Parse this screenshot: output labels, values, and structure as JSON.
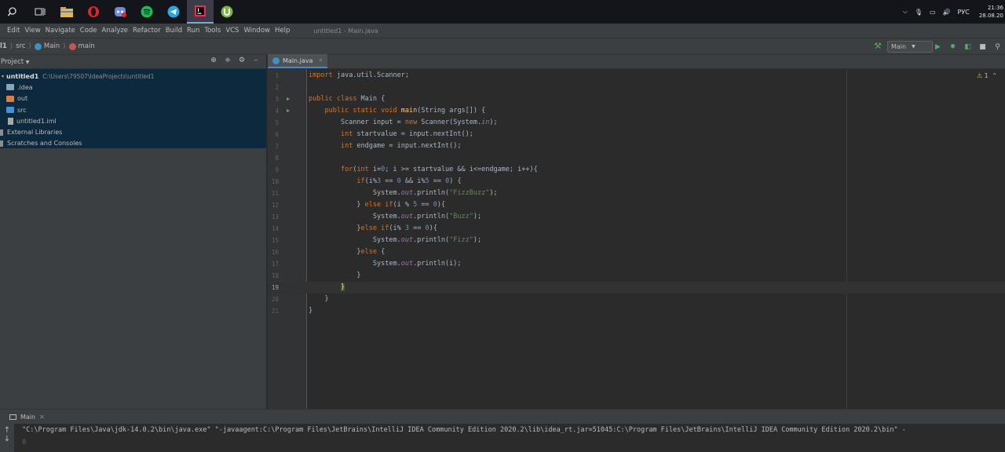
{
  "taskbar": {
    "apps": [
      "search",
      "task-view",
      "explorer",
      "opera",
      "discord",
      "spotify",
      "telegram",
      "intellij",
      "torrent"
    ],
    "lang": "РУС",
    "time": "21:36",
    "date": "28.08.20"
  },
  "menu": {
    "items": [
      "Edit",
      "View",
      "Navigate",
      "Code",
      "Analyze",
      "Refactor",
      "Build",
      "Run",
      "Tools",
      "VCS",
      "Window",
      "Help"
    ],
    "window_title": "untitled1 - Main.java"
  },
  "nav": {
    "project": "l1",
    "src": "src",
    "cls": "Main",
    "method": "main",
    "run_config": "Main"
  },
  "project": {
    "title": "Project",
    "root": "untitled1",
    "root_path": "C:\\Users\\79507\\IdeaProjects\\untitled1",
    "items": [
      ".idea",
      "out",
      "src",
      "untitled1.iml"
    ],
    "ext_libs": "External Libraries",
    "scratches": "Scratches and Consoles"
  },
  "editor": {
    "tab": "Main.java",
    "warnings": "1",
    "lines": [
      "import java.util.Scanner;",
      "",
      "public class Main {",
      "    public static void main(String args[]) {",
      "        Scanner input = new Scanner(System.in);",
      "        int startvalue = input.nextInt();",
      "        int endgame = input.nextInt();",
      "",
      "        for(int i=0; i >= startvalue && i<=endgame; i++){",
      "            if(i%3 == 0 && i%5 == 0) {",
      "                System.out.println(\"FizzBuzz\");",
      "            } else if(i % 5 == 0){",
      "                System.out.println(\"Buzz\");",
      "            }else if(i% 3 == 0){",
      "                System.out.println(\"Fizz\");",
      "            }else {",
      "                System.out.println(i);",
      "            }",
      "        }",
      "    }",
      "}"
    ],
    "current_line": 19
  },
  "run": {
    "tab": "Main",
    "command": "\"C:\\Program Files\\Java\\jdk-14.0.2\\bin\\java.exe\" \"-javaagent:C:\\Program Files\\JetBrains\\IntelliJ IDEA Community Edition 2020.2\\lib\\idea_rt.jar=51045:C:\\Program Files\\JetBrains\\IntelliJ IDEA Community Edition 2020.2\\bin\" -",
    "second": "0"
  },
  "colors": {
    "keyword": "#cc7832",
    "string": "#6a8759",
    "number": "#6897bb",
    "selection": "#0d293e"
  }
}
